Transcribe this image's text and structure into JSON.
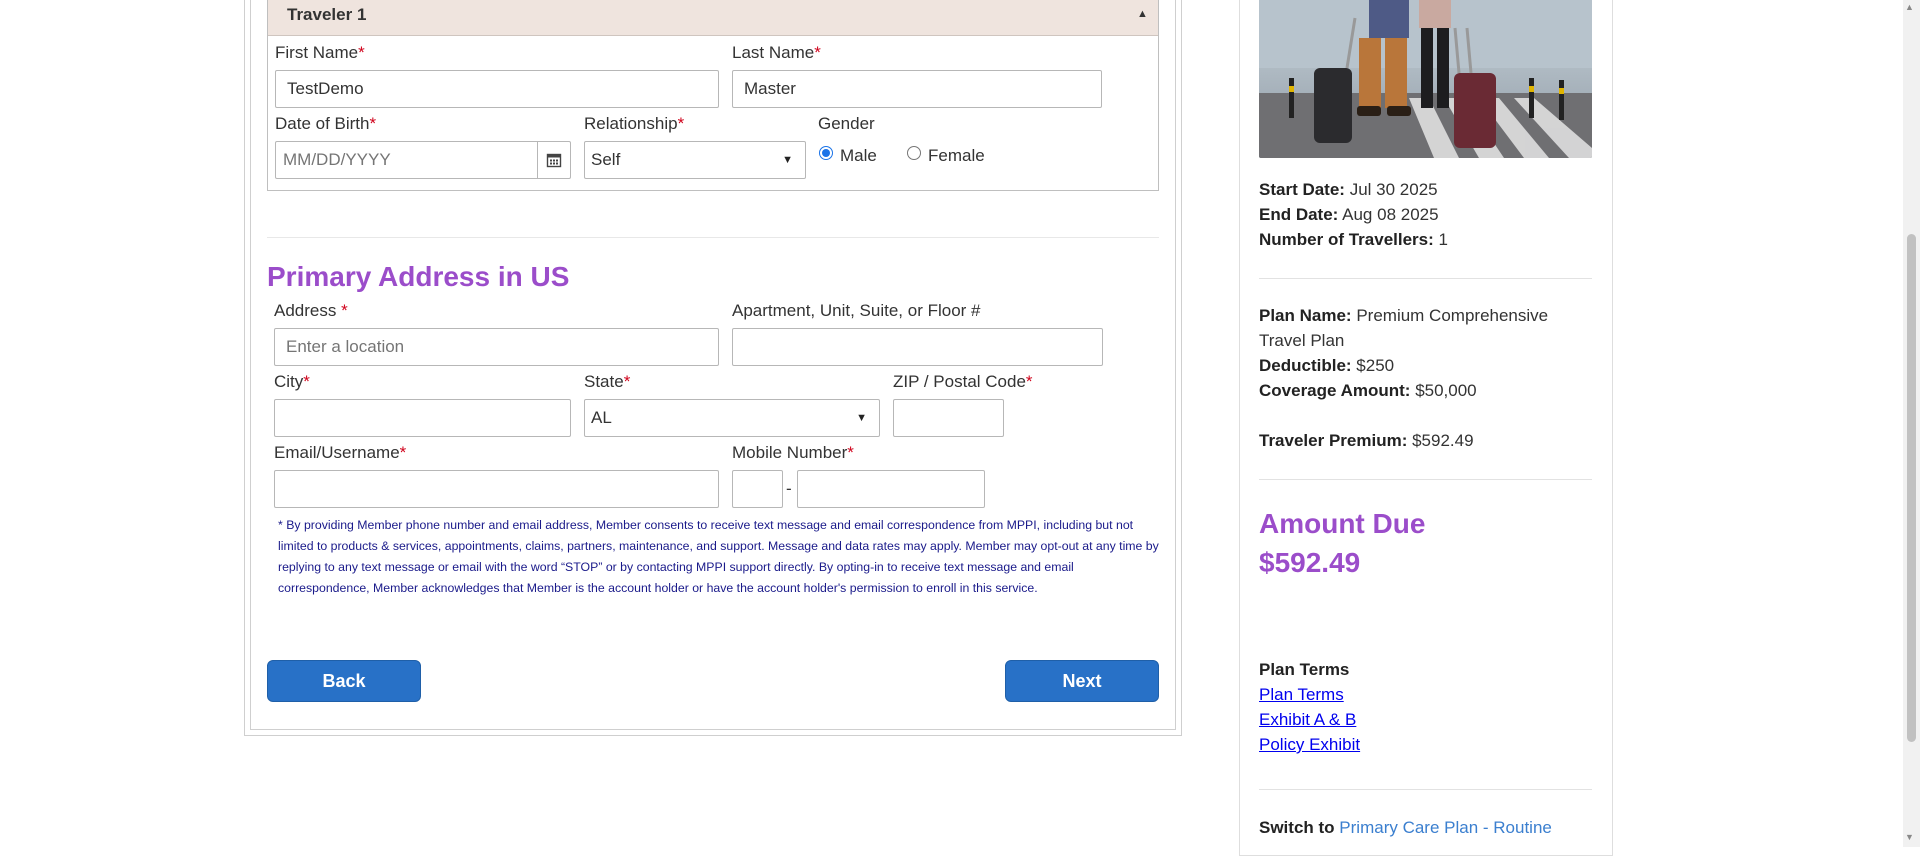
{
  "traveler": {
    "title": "Traveler 1",
    "first_name_label": "First Name",
    "first_name_value": "TestDemo",
    "last_name_label": "Last Name",
    "last_name_value": "Master",
    "dob_label": "Date of Birth",
    "dob_placeholder": "MM/DD/YYYY",
    "relationship_label": "Relationship",
    "relationship_value": "Self",
    "gender_label": "Gender",
    "gender_options": [
      "Male",
      "Female"
    ],
    "gender_selected": "Male",
    "required_mark": "*"
  },
  "address": {
    "section_title": "Primary Address in US",
    "address_label": "Address ",
    "address_placeholder": "Enter a location",
    "apt_label": "Apartment, Unit, Suite, or Floor #",
    "city_label": "City",
    "state_label": "State",
    "state_value": "AL",
    "zip_label": "ZIP / Postal Code",
    "email_label": "Email/Username",
    "mobile_label": "Mobile Number",
    "mobile_separator": "-",
    "consent_text": "* By providing Member phone number and email address, Member consents to receive text message and email correspondence from MPPI, including but not limited to products & services, appointments, claims, partners, maintenance, and support. Message and data rates may apply. Member may opt-out at any time by replying to any text message or email with the word “STOP” or by contacting MPPI support directly. By opting-in to receive text message and email correspondence, Member acknowledges that Member is the account holder or have the account holder's permission to enroll in this service."
  },
  "nav": {
    "back_label": "Back",
    "next_label": "Next"
  },
  "summary": {
    "start_date_label": "Start Date:",
    "start_date_value": "Jul 30 2025",
    "end_date_label": "End Date:",
    "end_date_value": "Aug 08 2025",
    "travellers_label": "Number of Travellers:",
    "travellers_value": "1",
    "plan_name_label": "Plan Name:",
    "plan_name_value_line1": "Premium Comprehensive",
    "plan_name_value_line2": "Travel Plan",
    "deductible_label": "Deductible:",
    "deductible_value": "$250",
    "coverage_label": "Coverage Amount:",
    "coverage_value": "$50,000",
    "premium_label": "Traveler Premium:",
    "premium_value": "$592.49",
    "amount_due_label": "Amount Due",
    "amount_due_value": "$592.49",
    "plan_terms_heading": "Plan Terms",
    "links": [
      "Plan Terms",
      "Exhibit A & B",
      "Policy Exhibit"
    ],
    "switch_prefix": "Switch to",
    "switch_link": "Primary Care Plan - Routine"
  },
  "colors": {
    "accent_purple": "#9b4dca",
    "button_blue": "#2871c7",
    "required_red": "#d0021b",
    "link_blue": "#0000ee",
    "header_tan": "#efe4de"
  }
}
